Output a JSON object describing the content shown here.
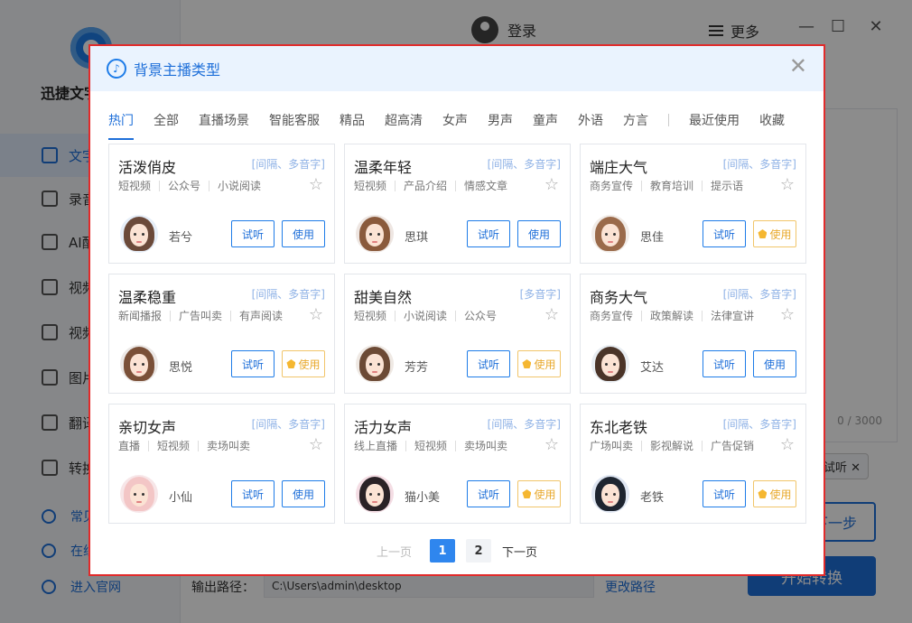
{
  "app": {
    "name": "迅捷文字",
    "login_label": "登录",
    "more_label": "更多",
    "nav": [
      {
        "label": "文字"
      },
      {
        "label": "录音"
      },
      {
        "label": "AI配"
      },
      {
        "label": "视频"
      },
      {
        "label": "视频"
      },
      {
        "label": "图片"
      },
      {
        "label": "翻译"
      },
      {
        "label": "转换"
      }
    ],
    "footer_links": [
      {
        "label": "常见"
      },
      {
        "label": "在线"
      },
      {
        "label": "进入官网"
      }
    ],
    "char_count": "0 / 3000",
    "trial_chip": "合试听 ✕",
    "next_label": "下一步",
    "start_label": "开始转换",
    "output_label": "输出路径：",
    "output_path": "C:\\Users\\admin\\desktop",
    "change_path_label": "更改路径"
  },
  "modal": {
    "title": "背景主播类型",
    "tabs": [
      "热门",
      "全部",
      "直播场景",
      "智能客服",
      "精品",
      "超高清",
      "女声",
      "男声",
      "童声",
      "外语",
      "方言"
    ],
    "tabs_extra": [
      "最近使用",
      "收藏"
    ],
    "active_tab": "热门",
    "try_label": "试听",
    "use_label": "使用",
    "cards": [
      {
        "name": "活泼俏皮",
        "feature": "[间隔、多音字]",
        "tags": [
          "短视频",
          "公众号",
          "小说阅读"
        ],
        "voice": "若兮",
        "vip": false,
        "hair": "#6b4a3a",
        "bg": "#e6eef8"
      },
      {
        "name": "温柔年轻",
        "feature": "[间隔、多音字]",
        "tags": [
          "短视频",
          "产品介绍",
          "情感文章"
        ],
        "voice": "思琪",
        "vip": false,
        "hair": "#8a5a3c",
        "bg": "#eee6e2"
      },
      {
        "name": "端庄大气",
        "feature": "[间隔、多音字]",
        "tags": [
          "商务宣传",
          "教育培训",
          "提示语"
        ],
        "voice": "思佳",
        "vip": true,
        "hair": "#9a6a4a",
        "bg": "#f1ece8"
      },
      {
        "name": "温柔稳重",
        "feature": "[间隔、多音字]",
        "tags": [
          "新闻播报",
          "广告叫卖",
          "有声阅读"
        ],
        "voice": "思悦",
        "vip": true,
        "hair": "#7a5038",
        "bg": "#ece8e6"
      },
      {
        "name": "甜美自然",
        "feature": "[多音字]",
        "tags": [
          "短视频",
          "小说阅读",
          "公众号"
        ],
        "voice": "芳芳",
        "vip": true,
        "hair": "#6c4a35",
        "bg": "#efe9e4"
      },
      {
        "name": "商务大气",
        "feature": "[间隔、多音字]",
        "tags": [
          "商务宣传",
          "政策解读",
          "法律宣讲"
        ],
        "voice": "艾达",
        "vip": false,
        "hair": "#4a3428",
        "bg": "#e8edf2"
      },
      {
        "name": "亲切女声",
        "feature": "[间隔、多音字]",
        "tags": [
          "直播",
          "短视频",
          "卖场叫卖"
        ],
        "voice": "小仙",
        "vip": false,
        "hair": "#f3c6c6",
        "bg": "#f7e6e8"
      },
      {
        "name": "活力女声",
        "feature": "[间隔、多音字]",
        "tags": [
          "线上直播",
          "短视频",
          "卖场叫卖"
        ],
        "voice": "猫小美",
        "vip": true,
        "hair": "#2a2226",
        "bg": "#f4dde4"
      },
      {
        "name": "东北老铁",
        "feature": "[间隔、多音字]",
        "tags": [
          "广场叫卖",
          "影视解说",
          "广告促销"
        ],
        "voice": "老铁",
        "vip": true,
        "hair": "#1e2530",
        "bg": "#dfe6f2"
      }
    ],
    "pagination": {
      "prev": "上一页",
      "pages": [
        "1",
        "2"
      ],
      "current": "1",
      "next": "下一页"
    }
  }
}
